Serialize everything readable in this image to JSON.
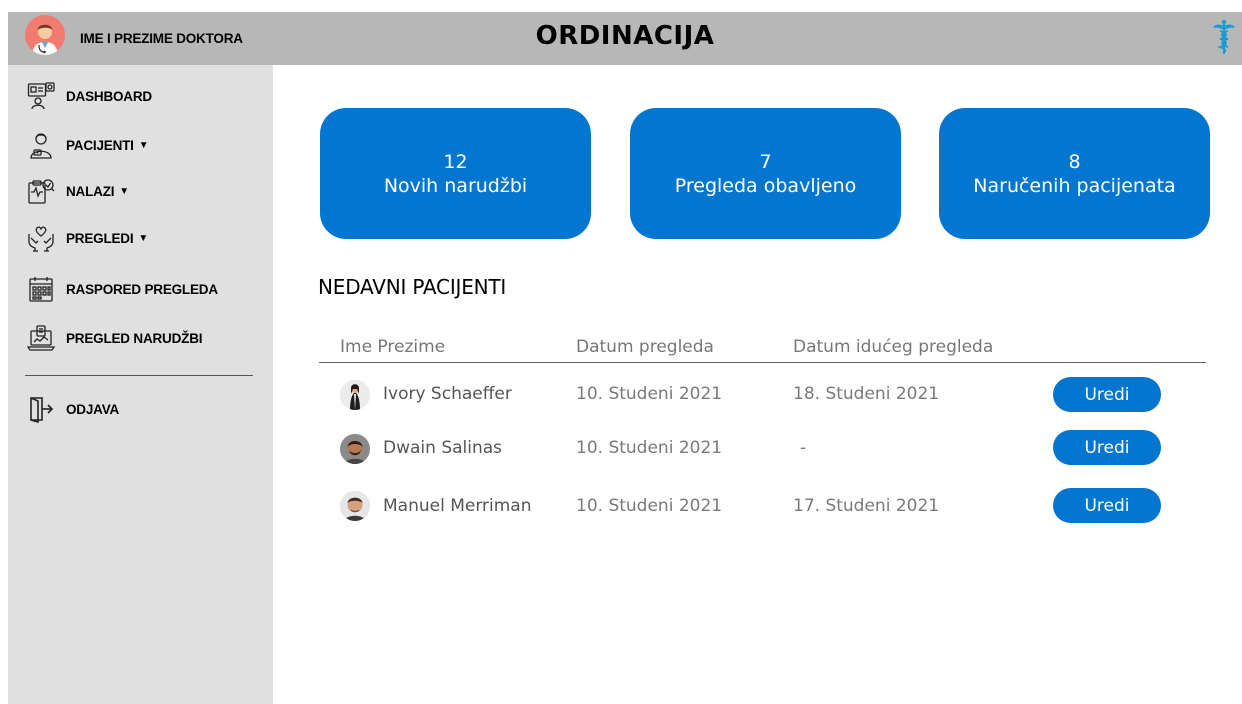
{
  "header": {
    "doctor_name": "IME I PREZIME DOKTORA",
    "app_title": "ORDINACIJA"
  },
  "sidebar": {
    "items": [
      {
        "label": "DASHBOARD",
        "icon": "dashboard-icon",
        "has_dropdown": false
      },
      {
        "label": "PACIJENTI",
        "icon": "patient-icon",
        "has_dropdown": true
      },
      {
        "label": "NALAZI",
        "icon": "lab-results-icon",
        "has_dropdown": true
      },
      {
        "label": "PREGLEDI",
        "icon": "care-hands-icon",
        "has_dropdown": true
      },
      {
        "label": "RASPORED PREGLEDA",
        "icon": "calendar-icon",
        "has_dropdown": false
      },
      {
        "label": "PREGLED NARUDŽBI",
        "icon": "orders-laptop-icon",
        "has_dropdown": false
      }
    ],
    "dropdown_glyph": "▼",
    "logout_label": "ODJAVA"
  },
  "stats": [
    {
      "value": "12",
      "label": "Novih narudžbi"
    },
    {
      "value": "7",
      "label": "Pregleda obavljeno"
    },
    {
      "value": "8",
      "label": "Naručenih pacijenata"
    }
  ],
  "recent": {
    "title": "NEDAVNI PACIJENTI",
    "columns": [
      "Ime Prezime",
      "Datum pregleda",
      "Datum idućeg pregleda"
    ],
    "rows": [
      {
        "name": "Ivory Schaeffer",
        "date": "10. Studeni 2021",
        "next_date": "18. Studeni 2021",
        "action": "Uredi"
      },
      {
        "name": "Dwain Salinas",
        "date": "10. Studeni 2021",
        "next_date": "-",
        "action": "Uredi"
      },
      {
        "name": "Manuel Merriman",
        "date": "10. Studeni 2021",
        "next_date": "17. Studeni 2021",
        "action": "Uredi"
      }
    ]
  },
  "colors": {
    "accent": "#0476d0",
    "header_bg": "#b7b7b7",
    "sidebar_bg": "#e0e0e0",
    "avatar_bg": "#f07b6e"
  }
}
